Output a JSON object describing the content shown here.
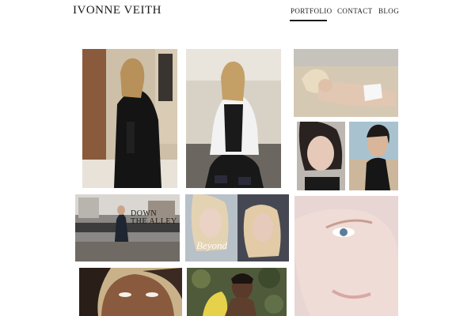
{
  "site": {
    "brand": "IVONNE VEITH"
  },
  "nav": {
    "items": [
      {
        "label": "PORTFOLIO",
        "active": true
      },
      {
        "label": "CONTACT",
        "active": false
      },
      {
        "label": "BLOG",
        "active": false
      }
    ]
  },
  "gallery": {
    "photos": [
      {
        "subject": "model-in-black-suit-photo"
      },
      {
        "subject": "model-in-white-jacket-photo"
      },
      {
        "subject": "blonde-model-on-beach-photo"
      },
      {
        "subject": "dark-haired-model-portrait-photo"
      },
      {
        "subject": "dark-haired-model-side-profile-photo"
      },
      {
        "subject": "magazine-street-spread-photo",
        "caption_top": "DOWN",
        "caption_bottom": "THE ALLEY"
      },
      {
        "subject": "beyond-magazine-spread-photo",
        "caption": "Beyond"
      },
      {
        "subject": "close-up-face-beauty-photo"
      },
      {
        "subject": "smiling-model-portrait-photo"
      },
      {
        "subject": "model-with-yellow-flowers-photo"
      }
    ]
  }
}
